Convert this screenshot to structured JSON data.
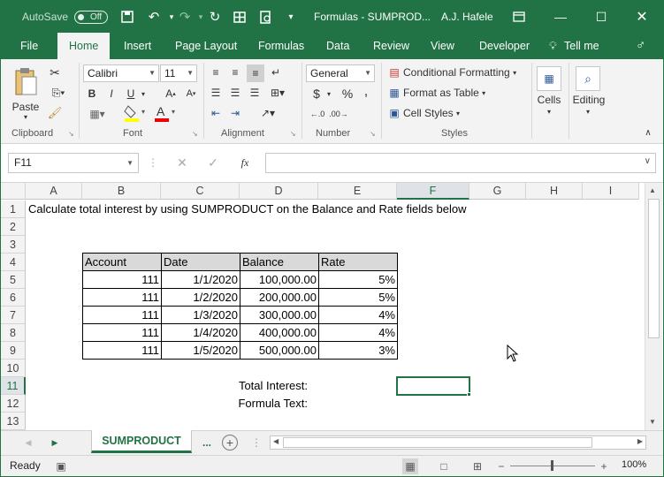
{
  "titlebar": {
    "autosave_label": "AutoSave",
    "autosave_state": "Off",
    "title": "Formulas - SUMPROD...",
    "user": "A.J. Hafele",
    "accent": "#217346"
  },
  "tabs": [
    "File",
    "Home",
    "Insert",
    "Page Layout",
    "Formulas",
    "Data",
    "Review",
    "View",
    "Developer",
    "Tell me"
  ],
  "active_tab": "Home",
  "ribbon": {
    "clipboard": {
      "paste": "Paste",
      "label": "Clipboard"
    },
    "font": {
      "name": "Calibri",
      "size": "11",
      "label": "Font",
      "bold": "B",
      "italic": "I",
      "underline": "U"
    },
    "alignment": {
      "label": "Alignment"
    },
    "number": {
      "format": "General",
      "currency": "$",
      "percent": "%",
      "comma": ",",
      "label": "Number"
    },
    "styles": {
      "conditional": "Conditional Formatting",
      "table": "Format as Table",
      "cell_styles": "Cell Styles",
      "label": "Styles"
    },
    "cells": {
      "label": "Cells"
    },
    "editing": {
      "label": "Editing"
    }
  },
  "formula_bar": {
    "name_box": "F11",
    "fx": "fx",
    "formula": ""
  },
  "columns": [
    "A",
    "B",
    "C",
    "D",
    "E",
    "F",
    "G",
    "H",
    "I"
  ],
  "selected_column": "F",
  "rows": [
    "1",
    "2",
    "3",
    "4",
    "5",
    "6",
    "7",
    "8",
    "9",
    "10",
    "11",
    "12",
    "13"
  ],
  "selected_row": "11",
  "sheet": {
    "a1": "Calculate total interest by using SUMPRODUCT on the Balance and Rate fields below",
    "table_headers": [
      "Account",
      "Date",
      "Balance",
      "Rate"
    ],
    "table_rows": [
      [
        "111",
        "1/1/2020",
        "100,000.00",
        "5%"
      ],
      [
        "111",
        "1/2/2020",
        "200,000.00",
        "5%"
      ],
      [
        "111",
        "1/3/2020",
        "300,000.00",
        "4%"
      ],
      [
        "111",
        "1/4/2020",
        "400,000.00",
        "4%"
      ],
      [
        "111",
        "1/5/2020",
        "500,000.00",
        "3%"
      ]
    ],
    "total_interest_label": "Total Interest:",
    "formula_text_label": "Formula Text:"
  },
  "sheet_tabs": {
    "active": "SUMPRODUCT",
    "more": "..."
  },
  "status": {
    "ready": "Ready",
    "zoom": "100%"
  }
}
